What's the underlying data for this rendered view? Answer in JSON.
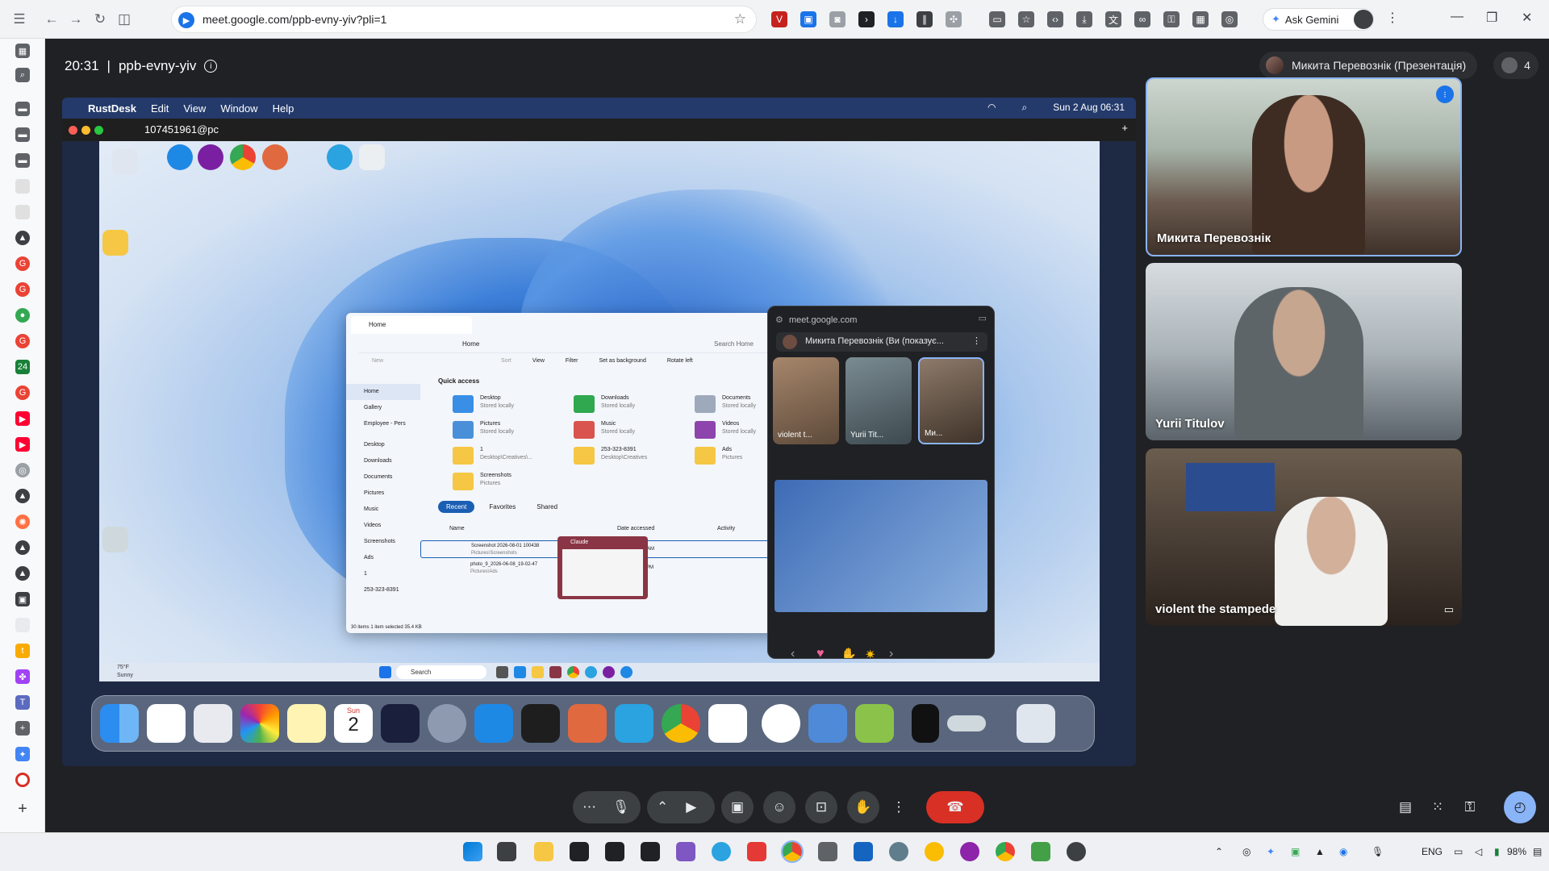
{
  "browser": {
    "url": "meet.google.com/ppb-evny-yiv?pli=1",
    "ask_gemini": "Ask Gemini"
  },
  "meet": {
    "time": "20:31",
    "separator": "|",
    "meeting_code": "ppb-evny-yiv",
    "presenter_chip": "Микита Перевознік (Презентація)",
    "participant_count": "4",
    "participants": [
      {
        "name": "Микита Перевознік"
      },
      {
        "name": "Yurii Titulov"
      },
      {
        "name": "violent the stampede"
      }
    ]
  },
  "shared_screen": {
    "mac_menu": {
      "app": "RustDesk",
      "items": [
        "Edit",
        "View",
        "Window",
        "Help"
      ],
      "clock": "Sun 2 Aug  06:31"
    },
    "rustdesk_tab": "107451961@pc",
    "explorer": {
      "tab_title": "Home",
      "breadcrumb": "Home",
      "search_placeholder": "Search Home",
      "toolbar": [
        "New",
        "Sort",
        "View",
        "Filter",
        "Set as background",
        "Rotate left"
      ],
      "sidebar": [
        "Home",
        "Gallery",
        "Employee - Pers",
        "Desktop",
        "Downloads",
        "Documents",
        "Pictures",
        "Music",
        "Videos",
        "Screenshots",
        "Ads",
        "1",
        "253-323-8391"
      ],
      "quick_access_title": "Quick access",
      "quick_access": [
        {
          "name": "Desktop",
          "sub": "Stored locally"
        },
        {
          "name": "Downloads",
          "sub": "Stored locally"
        },
        {
          "name": "Documents",
          "sub": "Stored locally"
        },
        {
          "name": "Pictures",
          "sub": "Stored locally"
        },
        {
          "name": "Music",
          "sub": "Stored locally"
        },
        {
          "name": "Videos",
          "sub": "Stored locally"
        },
        {
          "name": "1",
          "sub": "Desktop\\Creatives\\..."
        },
        {
          "name": "253-323-8391",
          "sub": "Desktop\\Creatives"
        },
        {
          "name": "Ads",
          "sub": "Pictures"
        },
        {
          "name": "Screenshots",
          "sub": "Pictures"
        }
      ],
      "tabs": [
        "Recent",
        "Favorites",
        "Shared"
      ],
      "columns": [
        "Name",
        "Date accessed",
        "Activity"
      ],
      "rows": [
        {
          "name": "Screenshot 2026-08-01 100438",
          "sub": "Pictures\\Screenshots",
          "date": "AM"
        },
        {
          "name": "photo_9_2026-06-08_19-02-47",
          "sub": "Pictures\\Ads",
          "date": "PM"
        }
      ],
      "status": "30 items    1 item selected  35.4 KB"
    },
    "claude_preview": "Claude",
    "weather": {
      "temp": "75°F",
      "desc": "Sunny"
    },
    "search": "Search",
    "pip": {
      "url": "meet.google.com",
      "presenting": "Микита Перевознік (Ви (показує...",
      "tiles": [
        "violent t...",
        "Yurii Tit...",
        "Ми..."
      ]
    },
    "dock_date": {
      "day": "Sun",
      "num": "2"
    }
  },
  "colors": {
    "meet_bg": "#202124",
    "end_call": "#d93025",
    "active_blue": "#8ab4f8"
  }
}
